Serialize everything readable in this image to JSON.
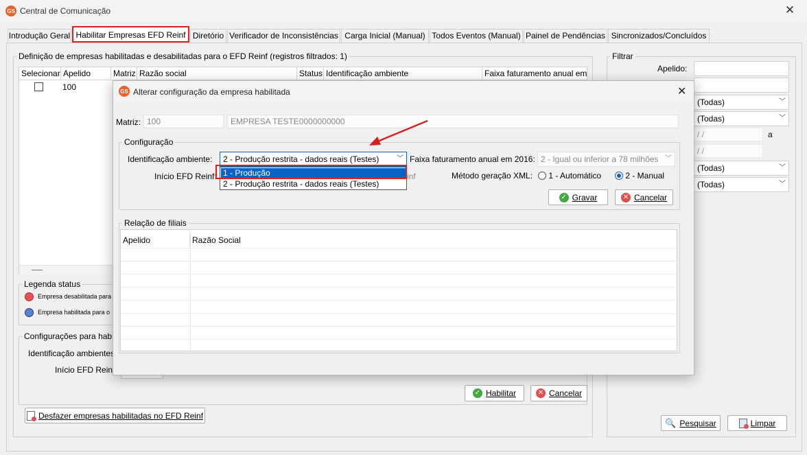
{
  "window": {
    "title": "Central de Comunicação",
    "logo_text": "GS",
    "close_glyph": "✕"
  },
  "tabs": [
    {
      "label": "Introdução Geral"
    },
    {
      "label": "Habilitar Empresas EFD Reinf"
    },
    {
      "label": "Diretório"
    },
    {
      "label": "Verificador de Inconsistências"
    },
    {
      "label": "Carga Inicial (Manual)"
    },
    {
      "label": "Todos Eventos (Manual)"
    },
    {
      "label": "Painel de Pendências"
    },
    {
      "label": "Sincronizados/Concluídos"
    }
  ],
  "main": {
    "group_title": "Definição de empresas habilitadas e desabilitadas para o EFD Reinf (registros filtrados: 1)",
    "columns": [
      "Selecionar",
      "Apelido",
      "Matriz",
      "Razão social",
      "Status",
      "Identificação ambiente",
      "Faixa faturamento anual em"
    ],
    "row": {
      "apelido": "100"
    },
    "legend_title": "Legenda status",
    "legend_items": [
      "Empresa desabilitada para",
      "Empresa habilitada para o"
    ],
    "config_title": "Configurações para habi",
    "config_ident_label": "Identificação ambientes",
    "config_inicio_label": "Início EFD Reinf:",
    "habilitar_button": "Habilitar",
    "cancelar_button": "Cancelar",
    "desfazer_button": "Desfazer empresas habilitadas no EFD Reinf"
  },
  "filter": {
    "title": "Filtrar",
    "apelido_label": "Apelido:",
    "todas": "(Todas)",
    "date_placeholder": "/ /",
    "a_label": "a",
    "pesquisar_button": "Pesquisar",
    "limpar_button": "Limpar"
  },
  "dialog": {
    "title": "Alterar configuração da empresa habilitada",
    "matriz_label": "Matriz:",
    "matriz_code": "100",
    "matriz_name": "EMPRESA TESTE0000000000",
    "config_title": "Configuração",
    "ident_label": "Identificação ambiente:",
    "ident_selected": "2 - Produção restrita - dados reais (Testes)",
    "ident_options": [
      "1 - Produção",
      "2 - Produção restrita - dados reais (Testes)"
    ],
    "inicio_label": "Início EFD Reinf:",
    "inicio_behind": "inf",
    "faixa_label": "Faixa faturamento anual em 2016:",
    "faixa_value": "2 - Igual ou inferior a 78 milhões",
    "metodo_label": "Método geração XML:",
    "metodo_options": [
      "1 - Automático",
      "2 - Manual"
    ],
    "metodo_selected": "2 - Manual",
    "gravar_button": "Gravar",
    "cancelar_button": "Cancelar",
    "filiais_title": "Relação de filiais",
    "filiais_columns": [
      "Apelido",
      "Razão Social"
    ]
  },
  "colors": {
    "highlight_red": "#e02020",
    "selection_blue": "#0a64c8",
    "arrow_red": "#d92020"
  }
}
